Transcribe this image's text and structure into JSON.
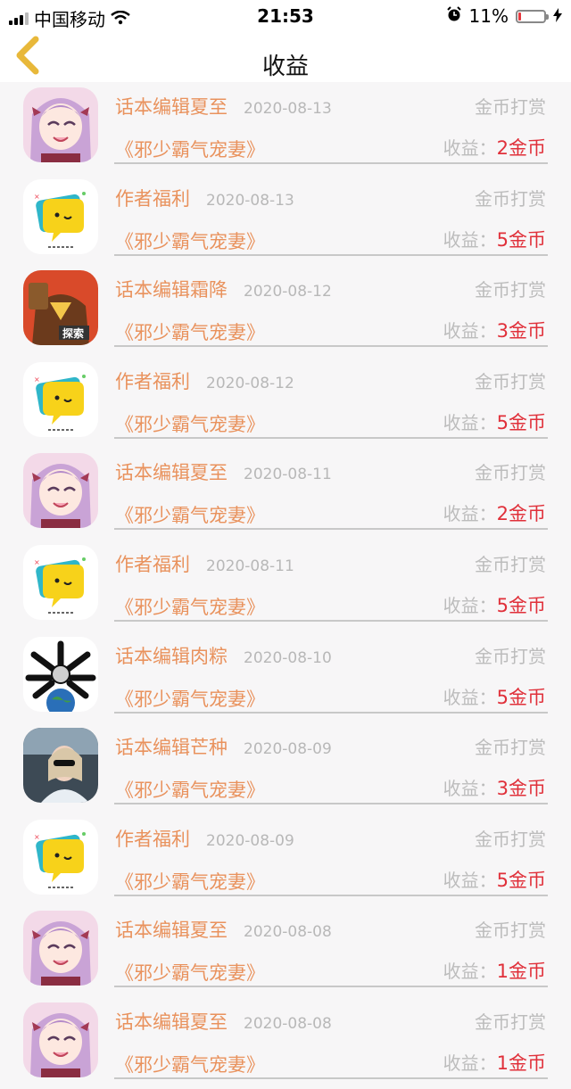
{
  "status_bar": {
    "carrier": "中国移动",
    "time": "21:53",
    "battery_percent": "11%",
    "battery_level": 0.11
  },
  "header": {
    "title": "收益"
  },
  "earnings_label": "收益：",
  "rows": [
    {
      "avatar": "anime-girl",
      "name": "话本编辑夏至",
      "date": "2020-08-13",
      "kind": "金币打赏",
      "book": "《邪少霸气宠妻》",
      "amount": "2金币"
    },
    {
      "avatar": "chat-bubble-logo",
      "name": "作者福利",
      "date": "2020-08-13",
      "kind": "金币打赏",
      "book": "《邪少霸气宠妻》",
      "amount": "5金币"
    },
    {
      "avatar": "cartoon-character",
      "name": "话本编辑霜降",
      "date": "2020-08-12",
      "kind": "金币打赏",
      "book": "《邪少霸气宠妻》",
      "amount": "3金币"
    },
    {
      "avatar": "chat-bubble-logo",
      "name": "作者福利",
      "date": "2020-08-12",
      "kind": "金币打赏",
      "book": "《邪少霸气宠妻》",
      "amount": "5金币"
    },
    {
      "avatar": "anime-girl",
      "name": "话本编辑夏至",
      "date": "2020-08-11",
      "kind": "金币打赏",
      "book": "《邪少霸气宠妻》",
      "amount": "2金币"
    },
    {
      "avatar": "chat-bubble-logo",
      "name": "作者福利",
      "date": "2020-08-11",
      "kind": "金币打赏",
      "book": "《邪少霸气宠妻》",
      "amount": "5金币"
    },
    {
      "avatar": "earth-bones",
      "name": "话本编辑肉粽",
      "date": "2020-08-10",
      "kind": "金币打赏",
      "book": "《邪少霸气宠妻》",
      "amount": "5金币"
    },
    {
      "avatar": "photo-woman",
      "name": "话本编辑芒种",
      "date": "2020-08-09",
      "kind": "金币打赏",
      "book": "《邪少霸气宠妻》",
      "amount": "3金币"
    },
    {
      "avatar": "chat-bubble-logo",
      "name": "作者福利",
      "date": "2020-08-09",
      "kind": "金币打赏",
      "book": "《邪少霸气宠妻》",
      "amount": "5金币"
    },
    {
      "avatar": "anime-girl",
      "name": "话本编辑夏至",
      "date": "2020-08-08",
      "kind": "金币打赏",
      "book": "《邪少霸气宠妻》",
      "amount": "1金币"
    },
    {
      "avatar": "anime-girl",
      "name": "话本编辑夏至",
      "date": "2020-08-08",
      "kind": "金币打赏",
      "book": "《邪少霸气宠妻》",
      "amount": "1金币"
    }
  ],
  "colors": {
    "accent": "#e9925d",
    "amount": "#e0303a",
    "back_arrow": "#e8b83a"
  }
}
